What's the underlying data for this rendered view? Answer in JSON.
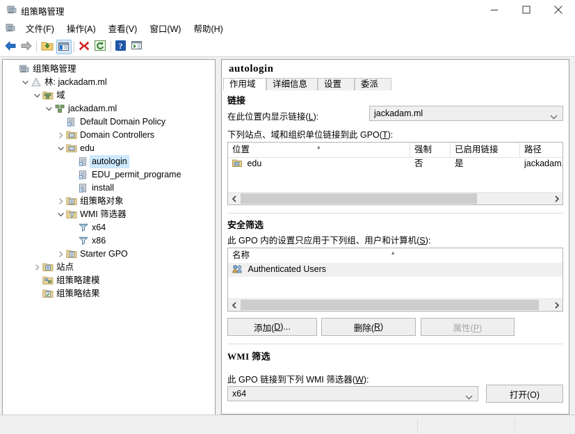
{
  "window": {
    "title": "组策略管理",
    "icon": "gpmc-icon",
    "buttons": {
      "minimize": "minimize-icon",
      "maximize": "maximize-icon",
      "close": "close-icon"
    },
    "mdi_buttons": {
      "minimize": "mdi-minimize-icon",
      "restore": "mdi-restore-icon",
      "close": "mdi-close-icon"
    }
  },
  "menubar": {
    "icon": "gpmc-icon",
    "items": [
      {
        "label": "文件(F)"
      },
      {
        "label": "操作(A)"
      },
      {
        "label": "查看(V)"
      },
      {
        "label": "窗口(W)"
      },
      {
        "label": "帮助(H)"
      }
    ]
  },
  "toolbar": {
    "buttons": [
      {
        "name": "back-arrow-icon"
      },
      {
        "name": "forward-arrow-icon"
      },
      {
        "name": "up-folder-icon"
      },
      {
        "name": "show-hide-tree-icon"
      },
      {
        "name": "delete-icon"
      },
      {
        "name": "refresh-icon"
      },
      {
        "name": "help-icon"
      },
      {
        "name": "properties-icon"
      }
    ]
  },
  "tree": {
    "items": [
      {
        "label": "组策略管理",
        "depth": 0,
        "expander": "none",
        "icon": "gpmc-icon",
        "selected": false
      },
      {
        "label": "林: jackadam.ml",
        "depth": 1,
        "expander": "expanded",
        "icon": "forest-icon",
        "selected": false
      },
      {
        "label": "域",
        "depth": 2,
        "expander": "expanded",
        "icon": "domains-icon",
        "selected": false
      },
      {
        "label": "jackadam.ml",
        "depth": 3,
        "expander": "expanded",
        "icon": "domain-icon",
        "selected": false
      },
      {
        "label": "Default Domain Policy",
        "depth": 4,
        "expander": "none",
        "icon": "gpo-link-icon",
        "selected": false
      },
      {
        "label": "Domain Controllers",
        "depth": 4,
        "expander": "collapsed",
        "icon": "ou-icon",
        "selected": false
      },
      {
        "label": "edu",
        "depth": 4,
        "expander": "expanded",
        "icon": "ou-icon",
        "selected": false
      },
      {
        "label": "autologin",
        "depth": 5,
        "expander": "none",
        "icon": "gpo-link-icon",
        "selected": true
      },
      {
        "label": "EDU_permit_programe",
        "depth": 5,
        "expander": "none",
        "icon": "gpo-link-icon",
        "selected": false
      },
      {
        "label": "install",
        "depth": 5,
        "expander": "none",
        "icon": "gpo-link-icon",
        "selected": false
      },
      {
        "label": "组策略对象",
        "depth": 4,
        "expander": "collapsed",
        "icon": "gpo-folder-icon",
        "selected": false
      },
      {
        "label": "WMI 筛选器",
        "depth": 4,
        "expander": "expanded",
        "icon": "wmi-folder-icon",
        "selected": false
      },
      {
        "label": "x64",
        "depth": 5,
        "expander": "none",
        "icon": "wmi-filter-icon",
        "selected": false
      },
      {
        "label": "x86",
        "depth": 5,
        "expander": "none",
        "icon": "wmi-filter-icon",
        "selected": false
      },
      {
        "label": "Starter GPO",
        "depth": 4,
        "expander": "collapsed",
        "icon": "starter-gpo-icon",
        "selected": false
      },
      {
        "label": "站点",
        "depth": 2,
        "expander": "collapsed",
        "icon": "sites-icon",
        "selected": false
      },
      {
        "label": "组策略建模",
        "depth": 2,
        "expander": "none",
        "icon": "modeling-icon",
        "selected": false
      },
      {
        "label": "组策略结果",
        "depth": 2,
        "expander": "none",
        "icon": "results-icon",
        "selected": false
      }
    ]
  },
  "detail": {
    "gpo_name": "autologin",
    "tabs": [
      {
        "label": "作用域",
        "active": true
      },
      {
        "label": "详细信息",
        "active": false
      },
      {
        "label": "设置",
        "active": false
      },
      {
        "label": "委派",
        "active": false
      }
    ],
    "links": {
      "heading": "链接",
      "scope_label": "在此位置内显示链接(L):",
      "scope_value": "jackadam.ml",
      "list_label": "下列站点、域和组织单位链接到此 GPO(T):",
      "columns": [
        "位置",
        "强制",
        "已启用链接",
        "路径"
      ],
      "rows": [
        {
          "location": "edu",
          "icon": "ou-icon",
          "enforced": "否",
          "link_enabled": "是",
          "path": "jackadam.ml/ed"
        }
      ],
      "scrollbar": {
        "left_arrow": "chevron-left-icon",
        "right_arrow": "chevron-right-icon"
      }
    },
    "security": {
      "heading": "安全筛选",
      "description": "此 GPO 内的设置只应用于下列组、用户和计算机(S):",
      "columns": [
        "名称"
      ],
      "rows": [
        {
          "name": "Authenticated Users",
          "icon": "users-group-icon"
        }
      ],
      "buttons": [
        {
          "label": "添加(D)...",
          "disabled": false,
          "name": "add-button"
        },
        {
          "label": "删除(R)",
          "disabled": false,
          "name": "remove-button"
        },
        {
          "label": "属性(P)",
          "disabled": true,
          "name": "properties-button"
        }
      ],
      "scrollbar": {
        "left_arrow": "chevron-left-icon",
        "right_arrow": "chevron-right-icon"
      }
    },
    "wmi": {
      "heading": "WMI 筛选",
      "description": "此 GPO 链接到下列 WMI 筛选器(W):",
      "value": "x64",
      "open_button": "打开(O)"
    }
  },
  "colors": {
    "accent": "#cce8ff",
    "window_bg": "#f0f0f0",
    "pane_bg": "#ffffff",
    "border": "#b4b4b4",
    "scroll_thumb": "#cdcdcd"
  }
}
